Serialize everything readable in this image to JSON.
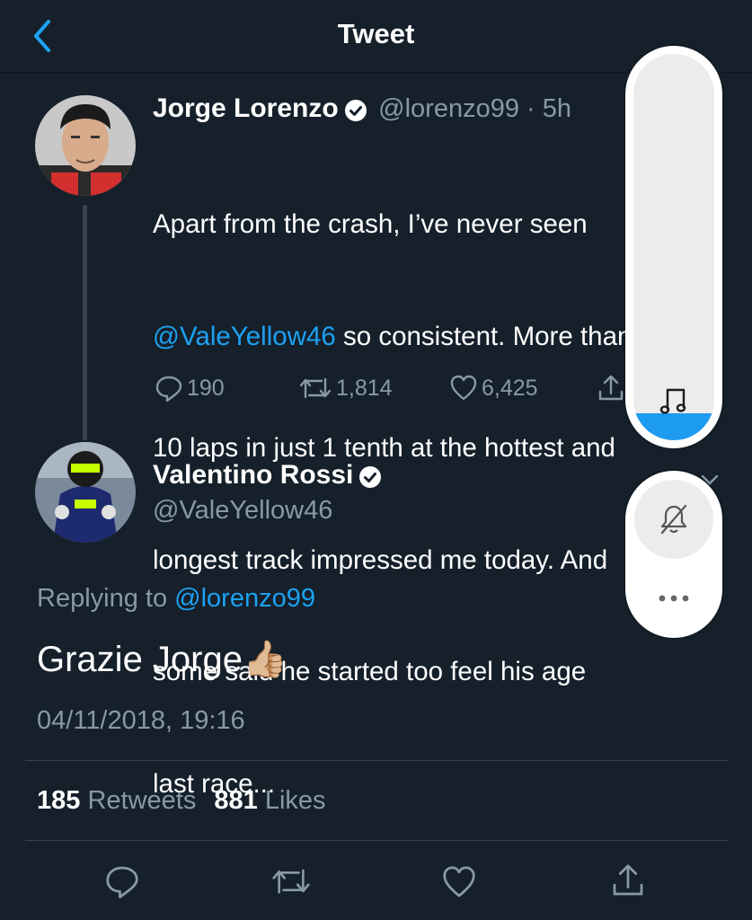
{
  "header": {
    "title": "Tweet"
  },
  "tweet1": {
    "name": "Jorge Lorenzo",
    "handle_time": "@lorenzo99 · 5h",
    "lines": [
      "Apart from the crash, I’ve never seen",
      "@ValeYellow46 so consistent. More than",
      "10 laps in just 1 tenth at the hottest and",
      "longest track impressed me today. And",
      "some said he started too feel his age",
      "last race..."
    ],
    "mention": "@ValeYellow46",
    "line2_rest": " so consistent. More than",
    "replies": "190",
    "retweets": "1,814",
    "likes": "6,425"
  },
  "tweet2": {
    "name": "Valentino Rossi",
    "handle": "@ValeYellow46",
    "replying_prefix": "Replying to ",
    "replying_to": "@lorenzo99",
    "text": "Grazie Jorge",
    "emoji": "👍🏼",
    "date": "04/11/2018, 19:16",
    "retweet_count": "185",
    "retweet_label": " Retweets",
    "like_count": "881",
    "like_label": " Likes"
  },
  "overlay": {
    "volume_level": 0.07,
    "accent": "#1d9bf0",
    "icons": [
      "music-note-icon",
      "bell-off-icon",
      "more-icon"
    ]
  },
  "colors": {
    "background": "#15202b",
    "accent": "#1da1f2",
    "muted": "#8899a6"
  }
}
